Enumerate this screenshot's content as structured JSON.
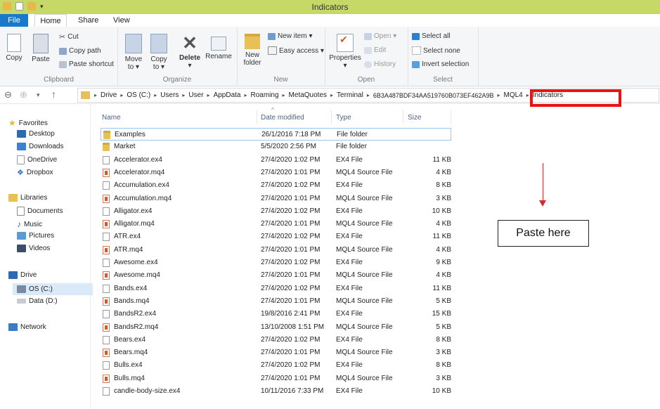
{
  "window": {
    "title": "Indicators"
  },
  "menu": {
    "file": "File",
    "home": "Home",
    "share": "Share",
    "view": "View"
  },
  "ribbon": {
    "clipboard": {
      "label": "Clipboard",
      "copy": "Copy",
      "paste": "Paste",
      "cut": "Cut",
      "copy_path": "Copy path",
      "paste_shortcut": "Paste shortcut"
    },
    "organize": {
      "label": "Organize",
      "move_to": "Move to ▾",
      "copy_to": "Copy to ▾",
      "delete": "Delete",
      "delete_arrow": "▾",
      "rename": "Rename"
    },
    "new": {
      "label": "New",
      "new_folder": "New folder",
      "new_item": "New item ▾",
      "easy_access": "Easy access ▾"
    },
    "open": {
      "label": "Open",
      "properties": "Properties",
      "properties_arrow": "▾",
      "open": "Open ▾",
      "edit": "Edit",
      "history": "History"
    },
    "select": {
      "label": "Select",
      "select_all": "Select all",
      "select_none": "Select none",
      "invert_selection": "Invert selection"
    }
  },
  "address": {
    "crumbs": [
      "Drive",
      "OS (C:)",
      "Users",
      "User",
      "AppData",
      "Roaming",
      "MetaQuotes",
      "Terminal",
      "6B3A487BDF34AA519760B073EF462A9B",
      "MQL4",
      "Indicators"
    ]
  },
  "nav": {
    "favorites": "Favorites",
    "desktop": "Desktop",
    "downloads": "Downloads",
    "onedrive": "OneDrive",
    "dropbox": "Dropbox",
    "libraries": "Libraries",
    "documents": "Documents",
    "music": "Music",
    "pictures": "Pictures",
    "videos": "Videos",
    "drive": "Drive",
    "os_c": "OS (C:)",
    "data_d": "Data (D:)",
    "network": "Network"
  },
  "columns": {
    "name": "Name",
    "date": "Date modified",
    "type": "Type",
    "size": "Size"
  },
  "files": [
    {
      "name": "Examples",
      "date": "26/1/2016 7:18 PM",
      "type": "File folder",
      "size": "",
      "kind": "folder"
    },
    {
      "name": "Market",
      "date": "5/5/2020 2:56 PM",
      "type": "File folder",
      "size": "",
      "kind": "folder"
    },
    {
      "name": "Accelerator.ex4",
      "date": "27/4/2020 1:02 PM",
      "type": "EX4 File",
      "size": "11 KB",
      "kind": "ex4"
    },
    {
      "name": "Accelerator.mq4",
      "date": "27/4/2020 1:01 PM",
      "type": "MQL4 Source File",
      "size": "4 KB",
      "kind": "mq4"
    },
    {
      "name": "Accumulation.ex4",
      "date": "27/4/2020 1:02 PM",
      "type": "EX4 File",
      "size": "8 KB",
      "kind": "ex4"
    },
    {
      "name": "Accumulation.mq4",
      "date": "27/4/2020 1:01 PM",
      "type": "MQL4 Source File",
      "size": "3 KB",
      "kind": "mq4"
    },
    {
      "name": "Alligator.ex4",
      "date": "27/4/2020 1:02 PM",
      "type": "EX4 File",
      "size": "10 KB",
      "kind": "ex4"
    },
    {
      "name": "Alligator.mq4",
      "date": "27/4/2020 1:01 PM",
      "type": "MQL4 Source File",
      "size": "4 KB",
      "kind": "mq4"
    },
    {
      "name": "ATR.ex4",
      "date": "27/4/2020 1:02 PM",
      "type": "EX4 File",
      "size": "11 KB",
      "kind": "ex4"
    },
    {
      "name": "ATR.mq4",
      "date": "27/4/2020 1:01 PM",
      "type": "MQL4 Source File",
      "size": "4 KB",
      "kind": "mq4"
    },
    {
      "name": "Awesome.ex4",
      "date": "27/4/2020 1:02 PM",
      "type": "EX4 File",
      "size": "9 KB",
      "kind": "ex4"
    },
    {
      "name": "Awesome.mq4",
      "date": "27/4/2020 1:01 PM",
      "type": "MQL4 Source File",
      "size": "4 KB",
      "kind": "mq4"
    },
    {
      "name": "Bands.ex4",
      "date": "27/4/2020 1:02 PM",
      "type": "EX4 File",
      "size": "11 KB",
      "kind": "ex4"
    },
    {
      "name": "Bands.mq4",
      "date": "27/4/2020 1:01 PM",
      "type": "MQL4 Source File",
      "size": "5 KB",
      "kind": "mq4"
    },
    {
      "name": "BandsR2.ex4",
      "date": "19/8/2016 2:41 PM",
      "type": "EX4 File",
      "size": "15 KB",
      "kind": "ex4"
    },
    {
      "name": "BandsR2.mq4",
      "date": "13/10/2008 1:51 PM",
      "type": "MQL4 Source File",
      "size": "5 KB",
      "kind": "mq4"
    },
    {
      "name": "Bears.ex4",
      "date": "27/4/2020 1:02 PM",
      "type": "EX4 File",
      "size": "8 KB",
      "kind": "ex4"
    },
    {
      "name": "Bears.mq4",
      "date": "27/4/2020 1:01 PM",
      "type": "MQL4 Source File",
      "size": "3 KB",
      "kind": "mq4"
    },
    {
      "name": "Bulls.ex4",
      "date": "27/4/2020 1:02 PM",
      "type": "EX4 File",
      "size": "8 KB",
      "kind": "ex4"
    },
    {
      "name": "Bulls.mq4",
      "date": "27/4/2020 1:01 PM",
      "type": "MQL4 Source File",
      "size": "3 KB",
      "kind": "mq4"
    },
    {
      "name": "candle-body-size.ex4",
      "date": "10/11/2016 7:33 PM",
      "type": "EX4 File",
      "size": "10 KB",
      "kind": "ex4"
    }
  ],
  "annotation": {
    "paste_here": "Paste here"
  },
  "colors": {
    "titlebar": "#c6d865",
    "file_tab": "#1979ca",
    "highlight_red": "#ee1111",
    "arrow_red": "#d92a2a"
  }
}
